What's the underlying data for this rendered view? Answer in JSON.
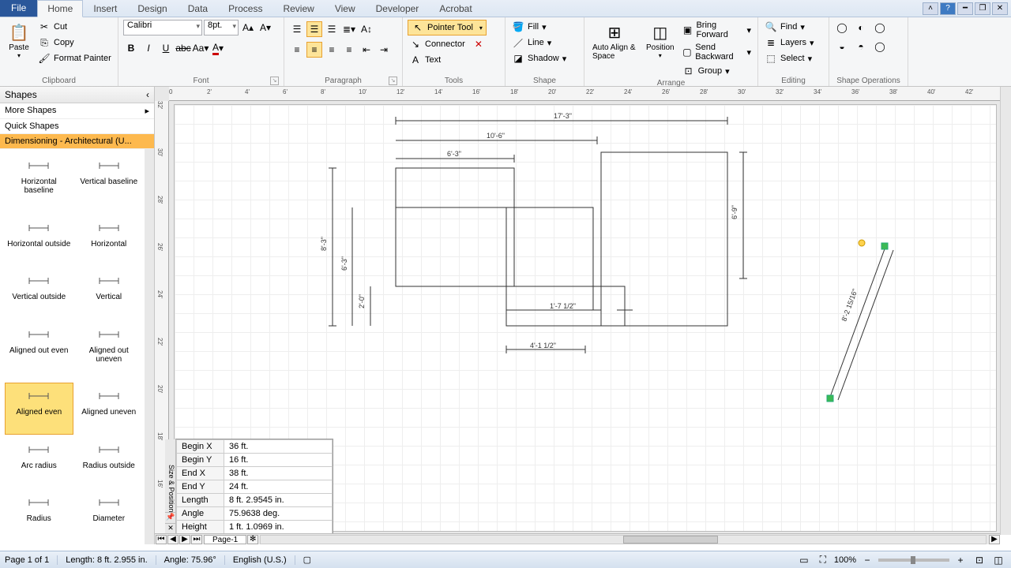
{
  "tabs": {
    "file": "File",
    "home": "Home",
    "insert": "Insert",
    "design": "Design",
    "data": "Data",
    "process": "Process",
    "review": "Review",
    "view": "View",
    "developer": "Developer",
    "acrobat": "Acrobat"
  },
  "clipboard": {
    "paste": "Paste",
    "cut": "Cut",
    "copy": "Copy",
    "format_painter": "Format Painter",
    "label": "Clipboard"
  },
  "font": {
    "name": "Calibri",
    "size": "8pt.",
    "label": "Font"
  },
  "paragraph": {
    "label": "Paragraph"
  },
  "tools": {
    "pointer": "Pointer Tool",
    "connector": "Connector",
    "text": "Text",
    "label": "Tools"
  },
  "shape": {
    "fill": "Fill",
    "line": "Line",
    "shadow": "Shadow",
    "label": "Shape"
  },
  "arrange": {
    "auto": "Auto Align & Space",
    "position": "Position",
    "bring_fwd": "Bring Forward",
    "send_back": "Send Backward",
    "group": "Group",
    "label": "Arrange"
  },
  "editing": {
    "find": "Find",
    "layers": "Layers",
    "select": "Select",
    "label": "Editing"
  },
  "shapeops": {
    "label": "Shape Operations"
  },
  "shapes_panel": {
    "title": "Shapes",
    "more": "More Shapes",
    "quick": "Quick Shapes",
    "stencil": "Dimensioning - Architectural (U...",
    "items": [
      "Horizontal baseline",
      "Vertical baseline",
      "Horizontal outside",
      "Horizontal",
      "Vertical outside",
      "Vertical",
      "Aligned out even",
      "Aligned out uneven",
      "Aligned even",
      "Aligned uneven",
      "Arc radius",
      "Radius outside",
      "Radius",
      "Diameter"
    ]
  },
  "dims": {
    "d1": "17'-3\"",
    "d2": "10'-6\"",
    "d3": "6'-3\"",
    "d4": "8'-3\"",
    "d5": "6'-3\"",
    "d6": "2'-0\"",
    "d7": "1'-7 1/2\"",
    "d8": "4'-1 1/2\"",
    "d9": "6'-9\"",
    "d10": "8'-2 15/16\""
  },
  "sizepos": {
    "title": "Size & Position",
    "rows": [
      {
        "k": "Begin X",
        "v": "36 ft."
      },
      {
        "k": "Begin Y",
        "v": "16 ft."
      },
      {
        "k": "End X",
        "v": "38 ft."
      },
      {
        "k": "End Y",
        "v": "24 ft."
      },
      {
        "k": "Length",
        "v": "8 ft. 2.9545 in."
      },
      {
        "k": "Angle",
        "v": "75.9638 deg."
      },
      {
        "k": "Height",
        "v": "1 ft. 1.0969 in."
      }
    ]
  },
  "page_tab": "Page-1",
  "status": {
    "page": "Page 1 of 1",
    "length": "Length: 8 ft. 2.955 in.",
    "angle": "Angle: 75.96°",
    "lang": "English (U.S.)",
    "zoom": "100%"
  },
  "ruler_h": [
    "0",
    "2'",
    "4'",
    "6'",
    "8'",
    "10'",
    "12'",
    "14'",
    "16'",
    "18'",
    "20'",
    "22'",
    "24'",
    "26'",
    "28'",
    "30'",
    "32'",
    "34'",
    "36'",
    "38'",
    "40'",
    "42'"
  ],
  "ruler_v": [
    "32'",
    "30'",
    "28'",
    "26'",
    "24'",
    "22'",
    "20'",
    "18'",
    "16'"
  ]
}
